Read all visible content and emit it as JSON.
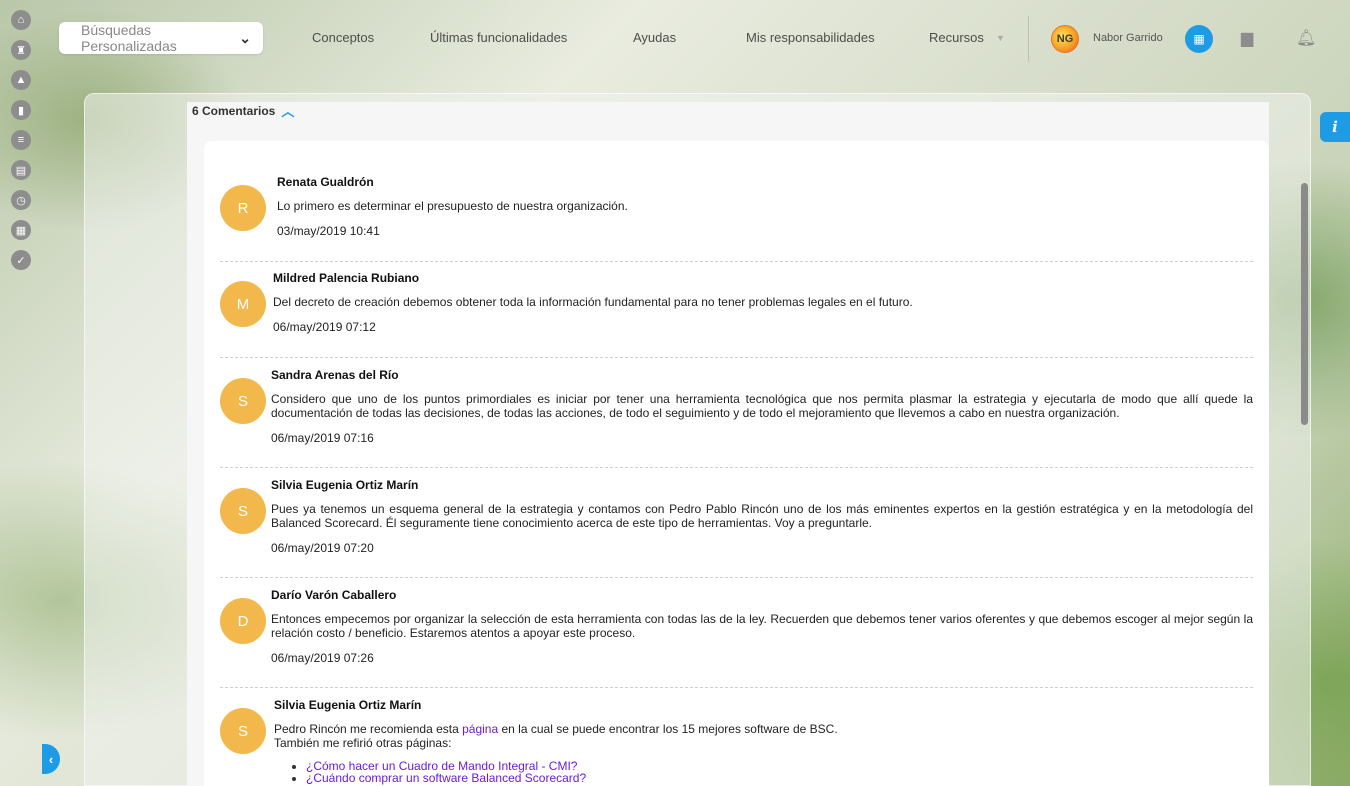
{
  "sidebar": {
    "icons": [
      "home-icon",
      "castle-icon",
      "pyramid-icon",
      "chart-icon",
      "list-icon",
      "book-icon",
      "clock-icon",
      "calendar-icon",
      "check-icon"
    ]
  },
  "topbar": {
    "search_label": "Búsquedas Personalizadas",
    "nav": [
      "Conceptos",
      "Últimas funcionalidades",
      "Ayudas",
      "Mis responsabilidades",
      "Recursos"
    ],
    "user_initials": "NG",
    "user_name": "Nabor Garrido"
  },
  "comments": {
    "header": "6 Comentarios",
    "items": [
      {
        "initial": "R",
        "author": "Renata Gualdrón",
        "text": "Lo primero es determinar el presupuesto de nuestra organización.",
        "date": "03/may/2019 10:41"
      },
      {
        "initial": "M",
        "author": "Mildred Palencia Rubiano",
        "text": "Del decreto de creación debemos obtener toda la información fundamental para no tener problemas legales en el futuro.",
        "date": "06/may/2019 07:12"
      },
      {
        "initial": "S",
        "author": "Sandra Arenas del Río",
        "text": "Considero que uno de los puntos primordiales es iniciar por tener una herramienta tecnológica que nos permita plasmar la estrategia y ejecutarla de modo que allí quede la documentación de todas las decisiones, de todas las acciones, de todo el seguimiento y de todo el mejoramiento que llevemos a cabo en nuestra organización.",
        "date": "06/may/2019 07:16"
      },
      {
        "initial": "S",
        "author": "Silvia Eugenia Ortiz Marín",
        "text": "Pues ya tenemos un esquema general de la estrategia y contamos con Pedro Pablo Rincón uno de los más eminentes expertos en la gestión estratégica y en la metodología del Balanced Scorecard.   Él seguramente tiene conocimiento acerca de este tipo de herramientas.   Voy a preguntarle.",
        "date": "06/may/2019 07:20"
      },
      {
        "initial": "D",
        "author": "Darío Varón Caballero",
        "text": "Entonces empecemos por organizar la selección de esta herramienta con todas las de la ley.   Recuerden que debemos tener varios oferentes y que debemos escoger al mejor según la relación costo / beneficio.   Estaremos atentos a apoyar este proceso.",
        "date": "06/may/2019 07:26"
      },
      {
        "initial": "S",
        "author": "Silvia Eugenia Ortiz Marín",
        "text_before": "Pedro Rincón me recomienda esta ",
        "link_text": "página",
        "text_after": " en la cual se puede encontrar los 15 mejores software de BSC.",
        "text_line2": "También me refirió otras páginas:",
        "links": [
          "¿Cómo hacer un Cuadro de Mando Integral - CMI?",
          "¿Cuándo comprar un software Balanced Scorecard?"
        ]
      }
    ]
  },
  "colors": {
    "accent": "#1e9be5",
    "avatar": "#f2b84b",
    "link": "#6b1bd9"
  }
}
